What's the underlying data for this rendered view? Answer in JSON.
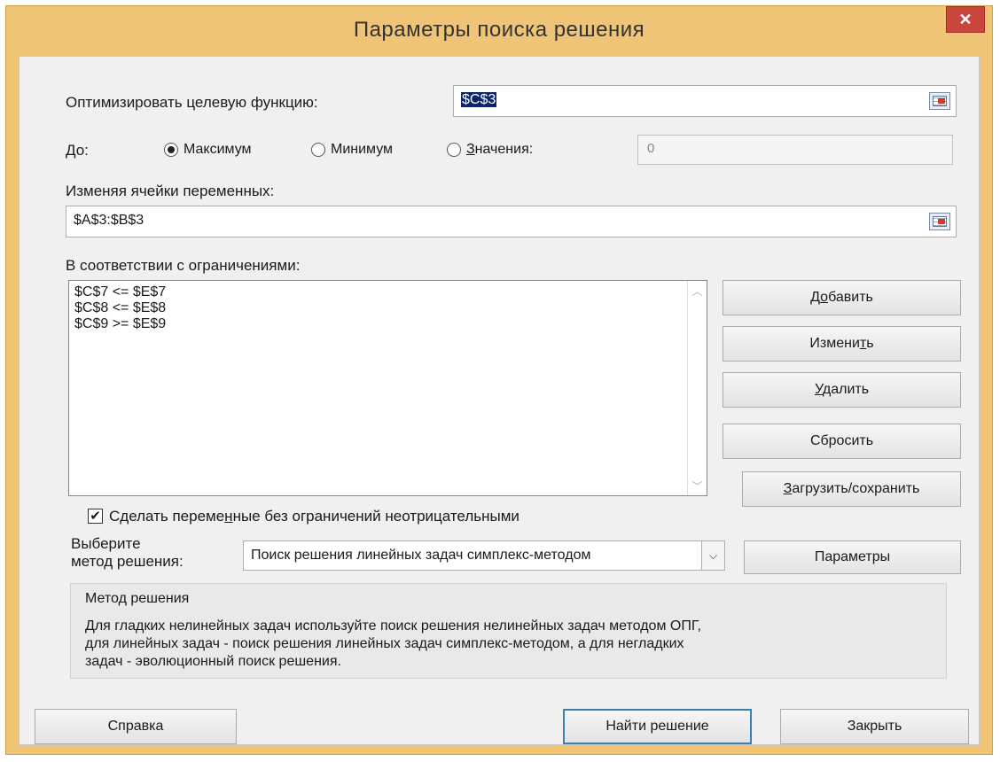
{
  "window": {
    "title": "Параметры поиска решения",
    "close": "✕"
  },
  "objective": {
    "label": "Оптимизировать целевую функцию:",
    "value": "$C$3"
  },
  "to": {
    "label": "До:",
    "options": [
      {
        "label": "Максимум",
        "selected": true
      },
      {
        "label": "Минимум",
        "selected": false
      },
      {
        "label": "Значения:",
        "selected": false
      }
    ],
    "value_field": "0"
  },
  "variables": {
    "label": "Изменяя ячейки переменных:",
    "value": "$A$3:$B$3"
  },
  "constraints": {
    "label": "В соответствии с ограничениями:",
    "items": [
      "$C$7 <= $E$7",
      "$C$8 <= $E$8",
      "$C$9 >= $E$9"
    ]
  },
  "side_buttons": {
    "add": "Добавить",
    "change": "Изменить",
    "delete": "Удалить",
    "reset": "Сбросить",
    "load_save": "Загрузить/сохранить"
  },
  "nonnegative": {
    "label": "Сделать переменные без ограничений неотрицательными",
    "checked": true
  },
  "method": {
    "label_line1": "Выберите",
    "label_line2": "метод решения:",
    "selected": "Поиск решения линейных задач симплекс-методом",
    "options_button": "Параметры"
  },
  "method_info": {
    "title": "Метод решения",
    "lines": [
      "Для гладких нелинейных задач используйте поиск решения нелинейных задач методом ОПГ,",
      "для линейных задач - поиск решения линейных задач симплекс-методом, а для негладких",
      "задач - эволюционный поиск решения."
    ]
  },
  "bottom_buttons": {
    "help": "Справка",
    "solve": "Найти решение",
    "close": "Закрыть"
  },
  "colors": {
    "frame": "#f0c476",
    "close_button": "#c9463d",
    "client_bg": "#f0f0f0",
    "default_button_border": "#3c7fb1"
  }
}
